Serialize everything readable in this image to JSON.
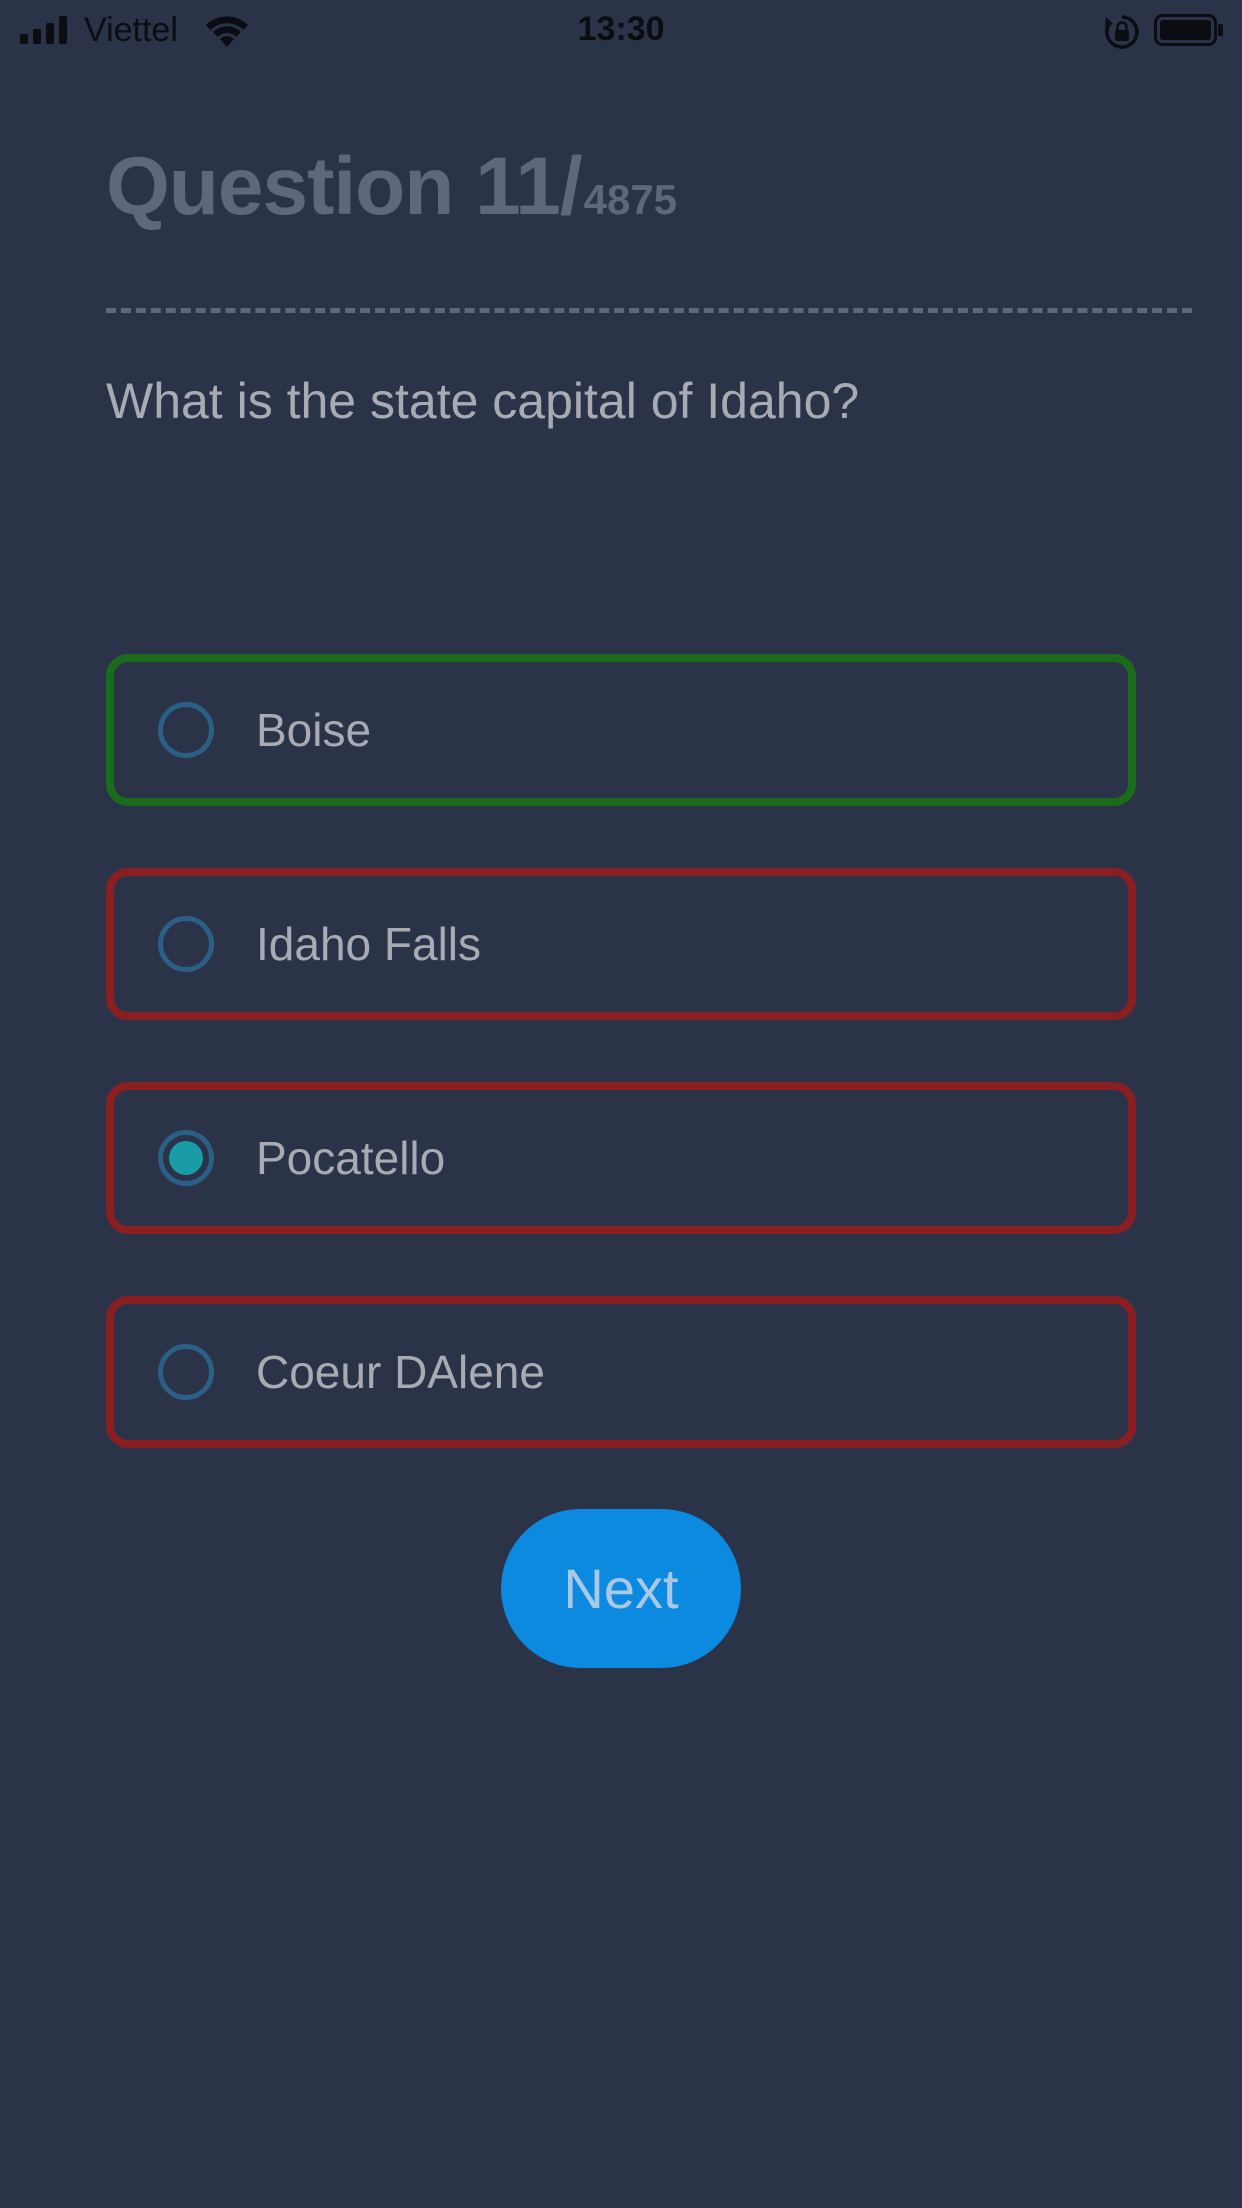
{
  "status_bar": {
    "carrier": "Viettel",
    "time": "13:30",
    "icons": [
      "signal-icon",
      "wifi-icon",
      "rotation-lock-icon",
      "battery-icon"
    ]
  },
  "quiz": {
    "question_label": "Question 11/",
    "question_total": "4875",
    "question_text": "What is the state capital of Idaho?",
    "answers": [
      {
        "label": "Boise",
        "status": "correct",
        "selected": false
      },
      {
        "label": "Idaho Falls",
        "status": "incorrect",
        "selected": false
      },
      {
        "label": "Pocatello",
        "status": "incorrect",
        "selected": true
      },
      {
        "label": "Coeur DAlene",
        "status": "incorrect",
        "selected": false
      }
    ],
    "next_label": "Next"
  },
  "colors": {
    "background": "#2b3349",
    "correct_border": "#1b6b1c",
    "incorrect_border": "#8a1f21",
    "radio_selected": "#1a9ca6",
    "next_button": "#0b8ae0"
  }
}
